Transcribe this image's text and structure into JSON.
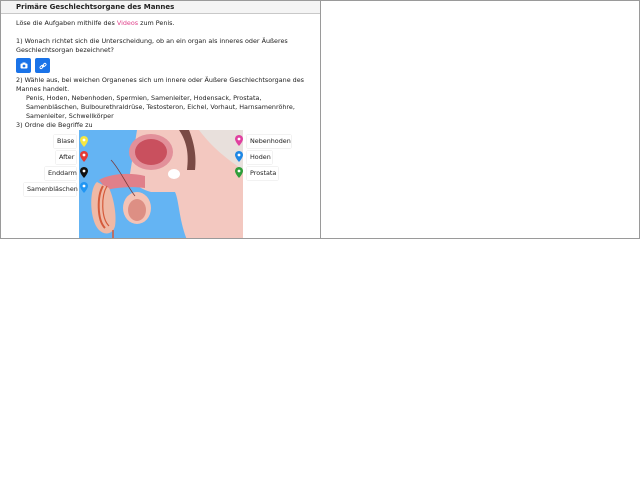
{
  "window": {
    "title": "Primäre Geschlechtsorgane des Mannes"
  },
  "intro": {
    "before": "Löse die Aufgaben mithilfe des ",
    "link": "Videos",
    "after": " zum Penis."
  },
  "task1": {
    "text": "1) Wonach richtet sich die Unterscheidung, ob an ein organ als inneres oder Äußeres Geschlechtsorgan bezeichnet?"
  },
  "buttons": {
    "camera_icon": "camera-icon",
    "link_icon": "link-icon"
  },
  "task2": {
    "text": "2) Wähle aus, bei weichen Organenes sich um innere oder Äußere Geschlechtsorgane des Mannes handelt.",
    "terms": "Penis, Hoden, Nebenhoden, Spermien, Samenleiter, Hodensack, Prostata, Samenbläschen, Bulbourethraldrüse, Testosteron, Eichel, Vorhaut, Harnsamenröhre, Samenleiter, Schwellkörper"
  },
  "task3": {
    "text": "3) Ordne die Begriffe zu"
  },
  "labels_left": [
    "Blase",
    "After",
    "Enddarm",
    "Samenbläschen"
  ],
  "labels_right": [
    "Nebenhoden",
    "Hoden",
    "Prostata"
  ],
  "pin_colors": {
    "left": [
      "#f5e642",
      "#e53935",
      "#111111",
      "#2196f3"
    ],
    "right": [
      "#e040a0",
      "#1e88e5",
      "#2e9e3a"
    ]
  },
  "figure": {
    "background": "#64b4f3"
  }
}
